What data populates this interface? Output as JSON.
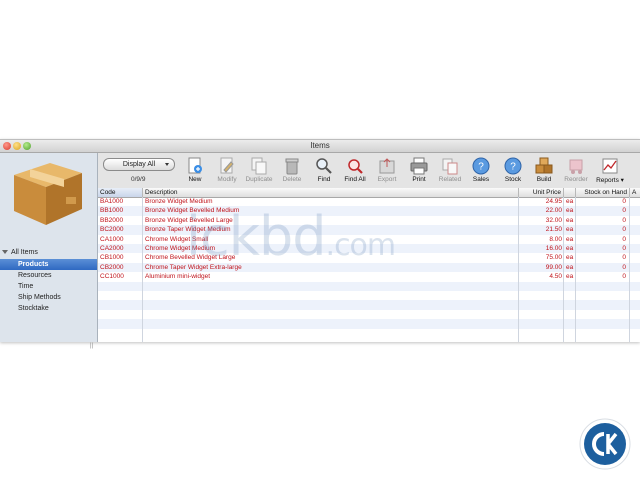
{
  "window": {
    "title": "Items"
  },
  "sidebar": {
    "root_label": "All Items",
    "items": [
      {
        "label": "Products",
        "selected": true
      },
      {
        "label": "Resources",
        "selected": false
      },
      {
        "label": "Time",
        "selected": false
      },
      {
        "label": "Ship Methods",
        "selected": false
      },
      {
        "label": "Stocktake",
        "selected": false
      }
    ]
  },
  "toolbar": {
    "display_select": "Display All",
    "counter": "0/9/9",
    "buttons": {
      "new": "New",
      "modify": "Modify",
      "duplicate": "Duplicate",
      "delete": "Delete",
      "find": "Find",
      "find_all": "Find All",
      "export": "Export",
      "print": "Print",
      "related": "Related",
      "sales": "Sales",
      "stock": "Stock",
      "build": "Build",
      "reorder": "Reorder",
      "reports": "Reports ▾"
    }
  },
  "table": {
    "columns": {
      "code": "Code",
      "description": "Description",
      "unit_price": "Unit Price",
      "stock_on_hand": "Stock on Hand",
      "sort": "A"
    },
    "rows": [
      {
        "code": "BA1000",
        "description": "Bronze Widget Medium",
        "price": "24.95",
        "unit": "ea",
        "stock": "0"
      },
      {
        "code": "BB1000",
        "description": "Bronze Widget Bevelled Medium",
        "price": "22.00",
        "unit": "ea",
        "stock": "0"
      },
      {
        "code": "BB2000",
        "description": "Bronze Widget Bevelled Large",
        "price": "32.00",
        "unit": "ea",
        "stock": "0"
      },
      {
        "code": "BC2000",
        "description": "Bronze Taper Widget Medium",
        "price": "21.50",
        "unit": "ea",
        "stock": "0"
      },
      {
        "code": "CA1000",
        "description": "Chrome Widget Small",
        "price": "8.00",
        "unit": "ea",
        "stock": "0"
      },
      {
        "code": "CA2000",
        "description": "Chrome Widget Medium",
        "price": "16.00",
        "unit": "ea",
        "stock": "0"
      },
      {
        "code": "CB1000",
        "description": "Chrome Bevelled Widget Large",
        "price": "75.00",
        "unit": "ea",
        "stock": "0"
      },
      {
        "code": "CB2000",
        "description": "Chrome Taper Widget Extra-large",
        "price": "99.00",
        "unit": "ea",
        "stock": "0"
      },
      {
        "code": "CC1000",
        "description": "Aluminium mini-widget",
        "price": "4.50",
        "unit": "ea",
        "stock": "0"
      }
    ]
  },
  "watermark": {
    "text": "ickbd",
    "suffix": ".com"
  },
  "colors": {
    "row_text": "#c0131b",
    "selection": "#3a73c8",
    "alt_row": "#edf2fb"
  }
}
